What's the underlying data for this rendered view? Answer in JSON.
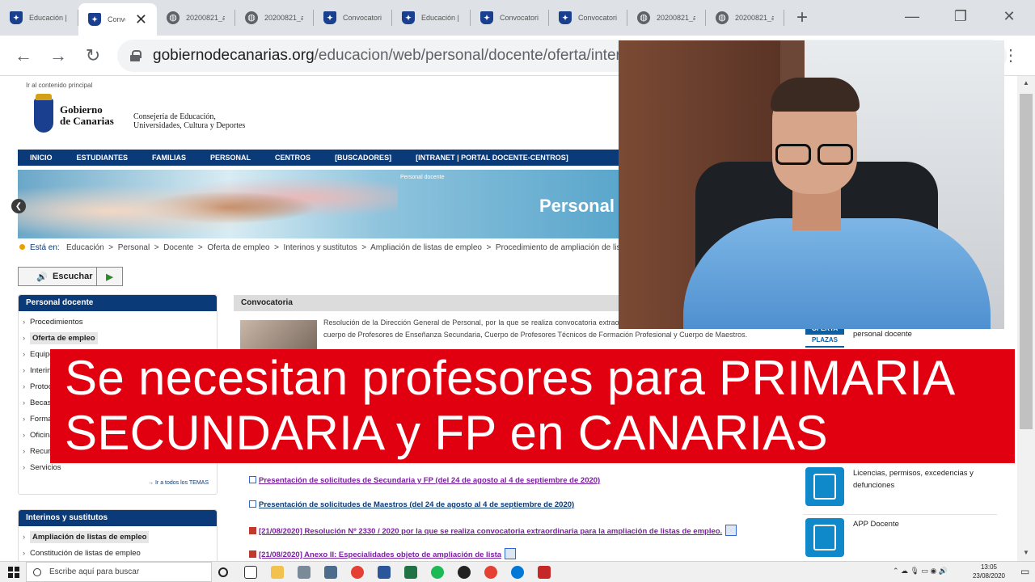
{
  "browser": {
    "tabs": [
      {
        "title": "Educación | Gobierno de Canarias",
        "icon": "gov-crest-icon"
      },
      {
        "title": "Convocatoria",
        "icon": "gov-crest-icon",
        "active": true
      },
      {
        "title": "20200821_anexo",
        "icon": "globe-icon"
      },
      {
        "title": "20200821_anexo",
        "icon": "globe-icon"
      },
      {
        "title": "Convocatoria",
        "icon": "gov-crest-icon"
      },
      {
        "title": "Educación | Gobierno de Canarias",
        "icon": "gov-crest-icon"
      },
      {
        "title": "Convocatoria",
        "icon": "gov-crest-icon"
      },
      {
        "title": "Convocatoria",
        "icon": "gov-crest-icon"
      },
      {
        "title": "20200821_anexo",
        "icon": "globe-icon"
      },
      {
        "title": "20200821_anexo",
        "icon": "globe-icon"
      }
    ],
    "url_host": "gobiernodecanarias.org",
    "url_path": "/educacion/web/personal/docente/oferta/interinos/ampliacion"
  },
  "site": {
    "skip_link": "Ir al contenido principal",
    "gov_name_1": "Gobierno",
    "gov_name_2": "de Canarias",
    "consejeria_1": "Consejería de Educación,",
    "consejeria_2": "Universidades, Cultura y Deportes",
    "nav": [
      "INICIO",
      "ESTUDIANTES",
      "FAMILIAS",
      "PERSONAL",
      "CENTROS",
      "[BUSCADORES]",
      "[INTRANET | PORTAL DOCENTE-CENTROS]"
    ],
    "banner_small": "Personal docente",
    "banner_big": "Personal",
    "breadcrumb_label": "Está en:",
    "breadcrumb": [
      "Educación",
      "Personal",
      "Docente",
      "Oferta de empleo",
      "Interinos y sustitutos",
      "Ampliación de listas de empleo",
      "Procedimiento de ampliación de listas"
    ],
    "escuchar": "Escuchar"
  },
  "sidebar": {
    "box1_title": "Personal docente",
    "box1_items": [
      "Procedimientos",
      "Oferta de empleo",
      "Equipos",
      "Interinos",
      "Protocolos",
      "Becas",
      "Formación",
      "Oficinas",
      "Recursos",
      "Servicios"
    ],
    "box1_selected": 1,
    "all_temas": "→ Ir a todos los TEMAS",
    "box2_title": "Interinos y sustitutos",
    "box2_items": [
      "Ampliación de listas de empleo",
      "Constitución de listas de empleo"
    ]
  },
  "main": {
    "section_title": "Convocatoria",
    "intro": "Resolución de la Dirección General de Personal, por la que se realiza convocatoria extraordinaria para la ampliación de listas de empleo del cuerpo de Profesores de Enseñanza Secundaria, Cuerpo de Profesores Técnicos de Formación Profesional y Cuerpo de Maestros.",
    "links": [
      {
        "text": "Presentación de solicitudes de Secundaria y FP (del 24 de agosto al 4 de septiembre de 2020)",
        "color": "#7b1fa2",
        "icon": "external-link-icon"
      },
      {
        "text": "Presentación de solicitudes de Maestros (del 24 de agosto al 4 de septiembre de 2020)",
        "color": "#0b3a78",
        "icon": "external-link-icon"
      },
      {
        "text": "[21/08/2020] Resolución Nº 2330 / 2020 por la que se realiza convocatoria extraordinaria para la ampliación de listas de empleo.",
        "color": "#7b1fa2",
        "icon": "pdf-icon"
      },
      {
        "text": "[21/08/2020] Anexo II: Especialidades objeto de ampliación de lista",
        "color": "#7b1fa2",
        "icon": "pdf-icon"
      }
    ]
  },
  "right_panel": {
    "oferta_top": "OFERTA",
    "oferta_bottom": "PLAZAS",
    "oferta_text": "personal docente",
    "licencias": "Licencias, permisos, excedencias y defunciones",
    "app": "APP Docente"
  },
  "caption": {
    "line1": "Se necesitan profesores para PRIMARIA",
    "line2": "SECUNDARIA y FP en CANARIAS"
  },
  "taskbar": {
    "search_placeholder": "Escribe aquí para buscar",
    "time": "13:05",
    "date": "23/08/2020"
  }
}
